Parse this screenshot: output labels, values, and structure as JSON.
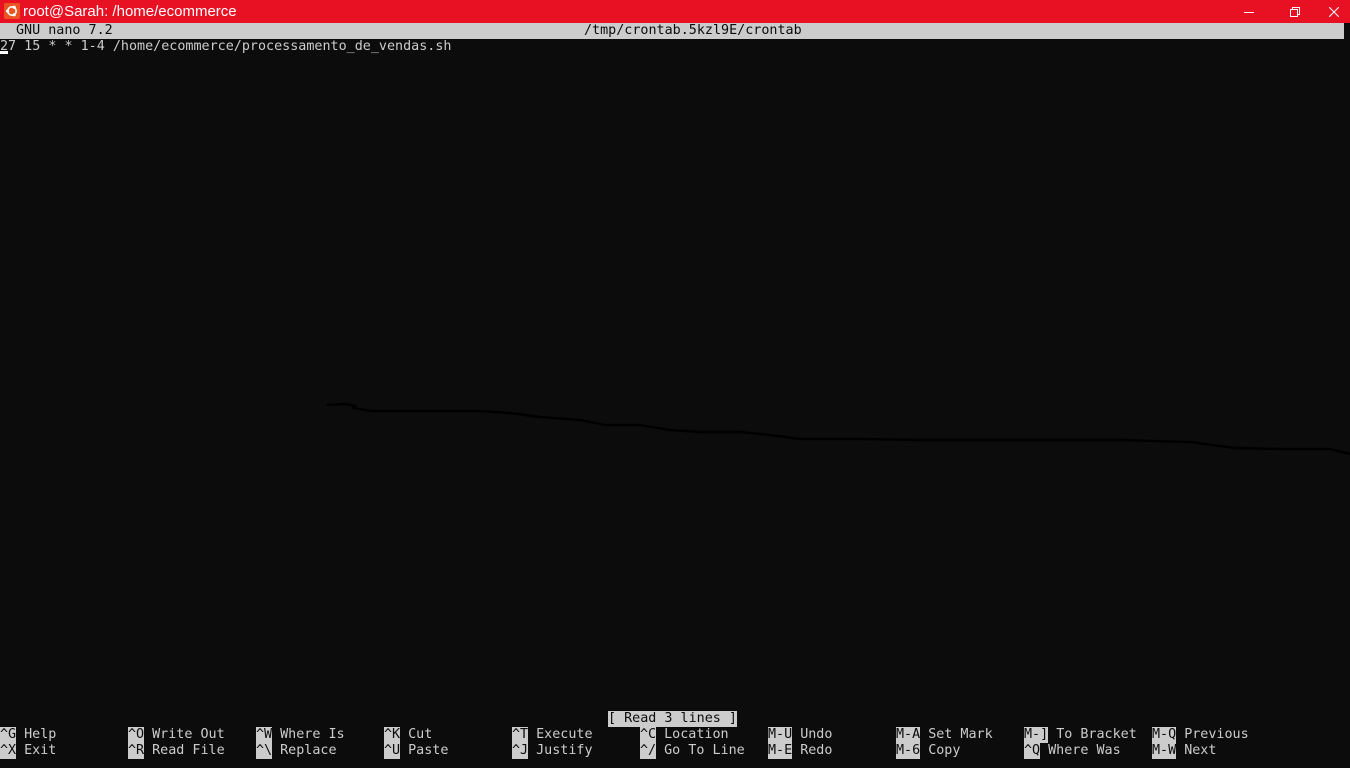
{
  "window": {
    "title": "root@Sarah: /home/ecommerce",
    "accent_color": "#e81123",
    "icons": {
      "app": "ubuntu-logo-icon",
      "minimize": "minimize-icon",
      "maximize": "restore-icon",
      "close": "close-icon"
    }
  },
  "editor": {
    "version": "GNU nano 7.2",
    "filename": "/tmp/crontab.5kzl9E/crontab",
    "lines": [
      "27 15 * * 1-4 /home/ecommerce/processamento_de_vendas.sh"
    ],
    "status_message": "[ Read 3 lines ]"
  },
  "shortcuts": {
    "row1": [
      {
        "key": "^G",
        "label": "Help"
      },
      {
        "key": "^O",
        "label": "Write Out"
      },
      {
        "key": "^W",
        "label": "Where Is"
      },
      {
        "key": "^K",
        "label": "Cut"
      },
      {
        "key": "^T",
        "label": "Execute"
      },
      {
        "key": "^C",
        "label": "Location"
      },
      {
        "key": "M-U",
        "label": "Undo"
      },
      {
        "key": "M-A",
        "label": "Set Mark"
      },
      {
        "key": "M-]",
        "label": "To Bracket"
      },
      {
        "key": "M-Q",
        "label": "Previous"
      }
    ],
    "row2": [
      {
        "key": "^X",
        "label": "Exit"
      },
      {
        "key": "^R",
        "label": "Read File"
      },
      {
        "key": "^\\",
        "label": "Replace"
      },
      {
        "key": "^U",
        "label": "Paste"
      },
      {
        "key": "^J",
        "label": "Justify"
      },
      {
        "key": "^/",
        "label": "Go To Line"
      },
      {
        "key": "M-E",
        "label": "Redo"
      },
      {
        "key": "M-6",
        "label": "Copy"
      },
      {
        "key": "^Q",
        "label": "Where Was"
      },
      {
        "key": "M-W",
        "label": "Next"
      }
    ]
  }
}
